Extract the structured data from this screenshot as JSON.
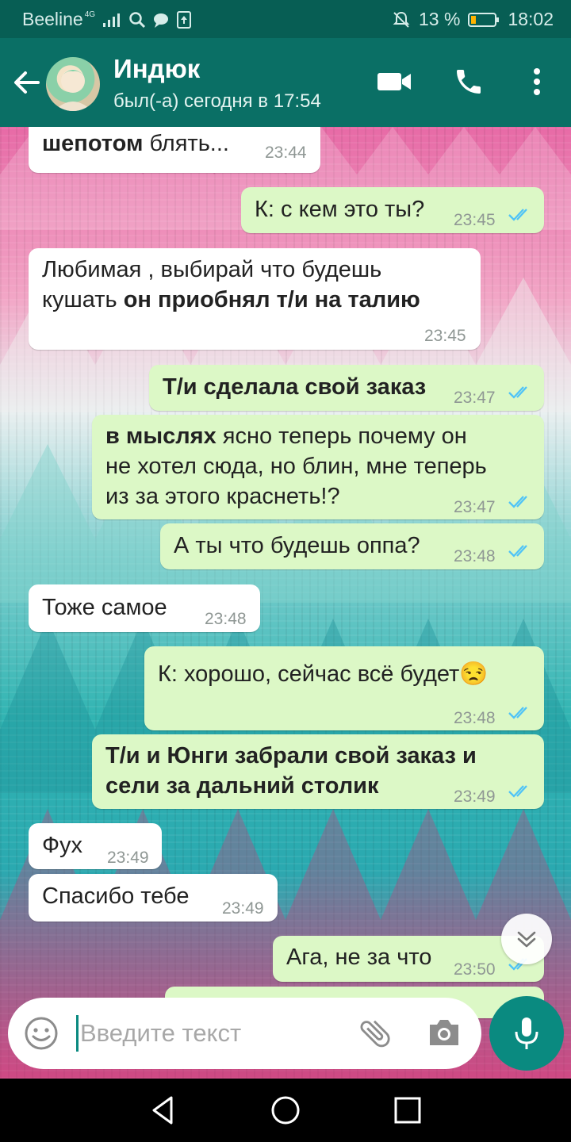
{
  "status_bar": {
    "carrier": "Beeline",
    "network": "4G",
    "battery_percent": "13 %",
    "time": "18:02"
  },
  "header": {
    "contact_name": "Индюк",
    "last_seen": "был(-а) сегодня в 17:54",
    "icons": [
      "back-arrow-icon",
      "video-call-icon",
      "phone-icon",
      "more-vert-icon"
    ]
  },
  "messages": [
    {
      "dir": "in",
      "bold": "шепотом",
      "text": " блять...",
      "time": "23:44"
    },
    {
      "dir": "out",
      "text": "К: с кем это ты?",
      "time": "23:45",
      "read": true
    },
    {
      "dir": "in",
      "line1": "Любимая , выбирай что будешь",
      "line2_plain": "кушать ",
      "line2_bold": "он приобнял т/и на талию",
      "time": "23:45"
    },
    {
      "dir": "out",
      "bold": "Т/и сделала свой заказ",
      "time": "23:47",
      "read": true
    },
    {
      "dir": "out",
      "bold": "в мыслях",
      "line1_rest": " ясно теперь почему он",
      "line2": "не хотел сюда, но блин, мне теперь",
      "line3": "из за этого краснеть!?",
      "time": "23:47",
      "read": true
    },
    {
      "dir": "out",
      "text": "А ты что будешь оппа?",
      "time": "23:48",
      "read": true
    },
    {
      "dir": "in",
      "text": "Тоже самое",
      "time": "23:48"
    },
    {
      "dir": "out",
      "text": "К: хорошо, сейчас всё будет",
      "emoji": "😒",
      "time": "23:48",
      "read": true
    },
    {
      "dir": "out",
      "line1": "Т/и и Юнги забрали свой заказ и",
      "line2": "сели за дальний столик",
      "time": "23:49",
      "read": true
    },
    {
      "dir": "in",
      "text": "Фух",
      "time": "23:49"
    },
    {
      "dir": "in",
      "text": "Спасибо тебе",
      "time": "23:49"
    },
    {
      "dir": "out",
      "text": "Ага, не за что",
      "time": "23:50",
      "read": true
    }
  ],
  "input": {
    "placeholder": "Введите текст"
  },
  "colors": {
    "header": "#0a6f65",
    "status_bar": "#075e54",
    "outgoing_bubble": "#dcf8c6",
    "incoming_bubble": "#ffffff",
    "read_ticks": "#4fc3f7",
    "mic_button": "#0a8a80"
  }
}
